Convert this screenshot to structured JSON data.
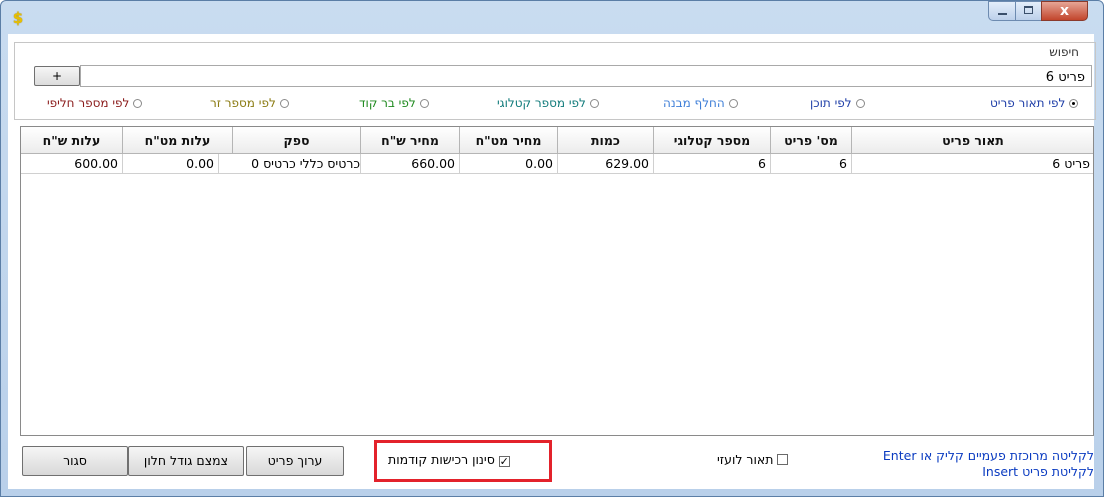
{
  "window": {
    "icon": "dollar-app-icon",
    "controls": {
      "minimize": "minimize-icon",
      "maximize": "maximize-icon",
      "close_glyph": "x"
    }
  },
  "search": {
    "group_label": "חיפוש",
    "plus_label": "+",
    "value": "פריט 6",
    "options": [
      {
        "id": "by-description",
        "label": "לפי תאור פריט",
        "selected": true,
        "color": "#1f3fa8"
      },
      {
        "id": "by-content",
        "label": "לפי תוכן",
        "selected": false,
        "color": "#1f3fa8"
      },
      {
        "id": "by-spare-part",
        "label": "החלף מבנה",
        "selected": false,
        "color": "#3f7fd8"
      },
      {
        "id": "by-catalog",
        "label": "לפי מספר קטלוגי",
        "selected": false,
        "color": "#0f7a7a"
      },
      {
        "id": "by-barcode",
        "label": "לפי בר קוד",
        "selected": false,
        "color": "#1f8a1f"
      },
      {
        "id": "by-foreign-number",
        "label": "לפי מספר זר",
        "selected": false,
        "color": "#8a7a10"
      },
      {
        "id": "by-alt-number",
        "label": "לפי מספר חליפי",
        "selected": false,
        "color": "#8a1a1a"
      }
    ]
  },
  "table": {
    "columns": [
      "תאור פריט",
      "מס' פריט",
      "מספר קטלוגי",
      "כמות",
      "מחיר מט\"ח",
      "מחיר ש\"ח",
      "ספק",
      "עלות מט\"ח",
      "עלות ש\"ח"
    ],
    "rows": [
      [
        "פריט 6",
        "6",
        "6",
        "629.00",
        "0.00",
        "660.00",
        "כרטיס כללי כרטיס 0",
        "0.00",
        "600.00"
      ]
    ]
  },
  "footer": {
    "close_label": "סגור",
    "shrink_label": "צמצם גודל חלון",
    "edit_label": "ערוך פריט",
    "prev_purchases_label": "סינון רכישות קודמות",
    "prev_purchases_checked": true,
    "foreign_desc_label": "תאור לועזי",
    "foreign_desc_checked": false,
    "hint_line1": "לקליטה מרוכזת פעמיים קליק או Enter",
    "hint_line2": "לקליטת פריט Insert"
  }
}
